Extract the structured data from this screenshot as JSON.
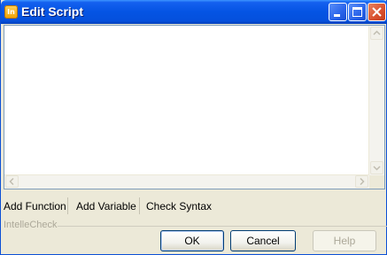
{
  "window": {
    "title": "Edit Script",
    "app_icon_text": "In"
  },
  "editor": {
    "content": ""
  },
  "toolbar": {
    "add_function": "Add Function",
    "add_variable": "Add Variable",
    "check_syntax": "Check Syntax"
  },
  "intellecheck": {
    "label": "IntelleCheck"
  },
  "buttons": {
    "ok": "OK",
    "cancel": "Cancel",
    "help": "Help"
  },
  "colors": {
    "titlebar": "#0554e3",
    "close_button": "#d9502e",
    "dialog_background": "#ece9d8"
  }
}
